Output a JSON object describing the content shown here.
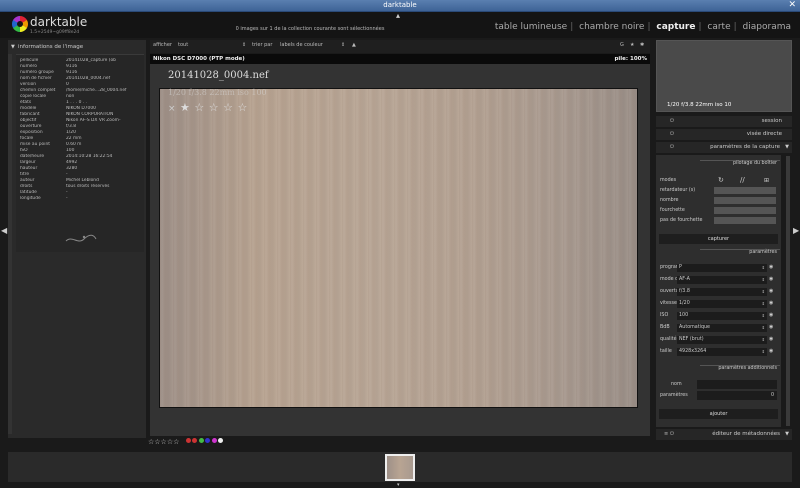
{
  "window_title": "darktable",
  "app": {
    "name": "darktable",
    "version": "1.5+2549~g09ff8e2d"
  },
  "header_status": "0 images sur 1 de la collection courante sont sélectionnées",
  "views": [
    "table lumineuse",
    "chambre noire",
    "capture",
    "carte",
    "diaporama"
  ],
  "active_view": "capture",
  "left_panel": {
    "title": "informations de l'image",
    "rows": [
      {
        "k": "pellicule",
        "v": "20141028_capture (ob"
      },
      {
        "k": "numéro",
        "v": "9116"
      },
      {
        "k": "numéro groupe",
        "v": "9116"
      },
      {
        "k": "nom de fichier",
        "v": "20141028_0004.nef"
      },
      {
        "k": "version",
        "v": "0"
      },
      {
        "k": "chemin complet",
        "v": "/home/miche…28_0004.nef"
      },
      {
        "k": "copie locale",
        "v": "non"
      },
      {
        "k": "états",
        "v": "1 . . . 0 . ."
      },
      {
        "k": "modèle",
        "v": "NIKON D7000"
      },
      {
        "k": "fabricant",
        "v": "NIKON CORPORATION"
      },
      {
        "k": "objectif",
        "v": "Nikon AF-S DX VR Zoom-"
      },
      {
        "k": "ouverture",
        "v": "f/3.8"
      },
      {
        "k": "exposition",
        "v": "1/20"
      },
      {
        "k": "focale",
        "v": "22 mm"
      },
      {
        "k": "mise au point",
        "v": "0.60 m"
      },
      {
        "k": "ISO",
        "v": "100"
      },
      {
        "k": "date/heure",
        "v": "2014:10:28 16:22:54"
      },
      {
        "k": "largeur",
        "v": "4992"
      },
      {
        "k": "hauteur",
        "v": "3280"
      },
      {
        "k": "titre",
        "v": "-"
      },
      {
        "k": "auteur",
        "v": "Michel Leblond"
      },
      {
        "k": "droits",
        "v": "tous droits réservés"
      },
      {
        "k": "latitude",
        "v": "-"
      },
      {
        "k": "longitude",
        "v": "-"
      }
    ]
  },
  "topbar": {
    "show_label": "afficher",
    "show_value": "tout",
    "sort_label": "trier par",
    "sort_value": "labels de couleur",
    "g_label": "G"
  },
  "camera_bar": {
    "camera": "Nikon DSC D7000 (PTP mode)",
    "battery": "pile: 100%"
  },
  "image": {
    "filename": "20141028_0004.nef",
    "overlay": "1/20 f/3.8 22mm iso 100",
    "reject": "×",
    "stars": [
      "★",
      "☆",
      "☆",
      "☆",
      "☆"
    ]
  },
  "rating_bar": {
    "stars": "☆☆☆☆☆",
    "colors": [
      "#c33",
      "#c33",
      "#4b4",
      "#33c",
      "#c3c",
      "#eee"
    ]
  },
  "right_panel": {
    "navigator_text": "1/20 f/3.8 22mm iso 10",
    "sections": [
      "session",
      "visée directe",
      "paramètres de la capture"
    ],
    "tether_head": "pilotage du boîtier",
    "tether_rows": [
      "modes",
      "retardateur (s)",
      "nombre",
      "fourchette",
      "pas de fourchette"
    ],
    "capture_btn": "capturer",
    "params_head": "paramètres",
    "params": [
      {
        "k": "programme",
        "v": "P"
      },
      {
        "k": "mode de focus",
        "v": "AF-A"
      },
      {
        "k": "ouverture",
        "v": "f/3.8"
      },
      {
        "k": "vitesse",
        "v": "1/20"
      },
      {
        "k": "ISO",
        "v": "100"
      },
      {
        "k": "BdB",
        "v": "Automatique"
      },
      {
        "k": "qualité",
        "v": "NEF (brut)"
      },
      {
        "k": "taille",
        "v": "4928x3264"
      }
    ],
    "extra_head": "paramètres additionnels",
    "extra_name": "nom",
    "extra_params": "paramètres",
    "extra_value": "0",
    "add_btn": "ajouter",
    "meta_editor": "éditeur de métadonnées"
  }
}
